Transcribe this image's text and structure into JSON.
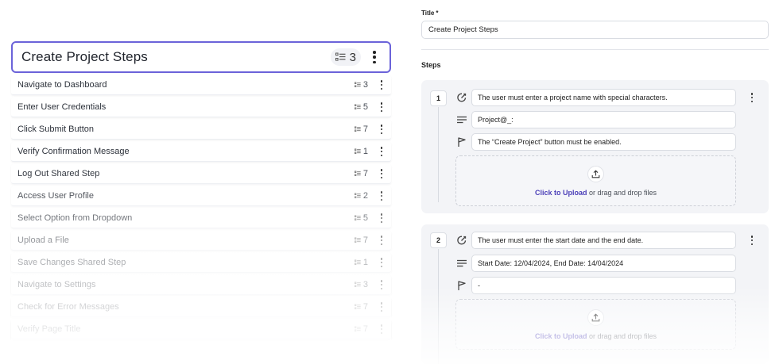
{
  "selected_shared_step": {
    "title": "Create Project Steps",
    "step_count": "3",
    "count_icon": "list-steps-icon",
    "menu_icon": "kebab-menu-icon"
  },
  "shared_steps": [
    {
      "label": "Navigate to Dashboard",
      "count": "3"
    },
    {
      "label": "Enter User Credentials",
      "count": "5"
    },
    {
      "label": "Click Submit Button",
      "count": "7"
    },
    {
      "label": "Verify Confirmation Message",
      "count": "1"
    },
    {
      "label": "Log Out Shared Step",
      "count": "7"
    },
    {
      "label": "Access User Profile",
      "count": "2"
    },
    {
      "label": "Select Option from Dropdown",
      "count": "5"
    },
    {
      "label": "Upload a File",
      "count": "7"
    },
    {
      "label": "Save Changes Shared Step",
      "count": "1"
    },
    {
      "label": "Navigate to Settings",
      "count": "3"
    },
    {
      "label": "Check for Error Messages",
      "count": "7"
    },
    {
      "label": "Verify Page Title",
      "count": "7"
    }
  ],
  "form": {
    "title_label": "Title",
    "required_marker": "*",
    "title_value": "Create Project Steps",
    "steps_label": "Steps"
  },
  "steps": [
    {
      "number": "1",
      "action": "The user must enter a project name with special characters.",
      "data": "Project@_:",
      "expected": "The “Create Project” button must be enabled.",
      "upload_link": "Click to Upload",
      "upload_rest": " or drag and drop files"
    },
    {
      "number": "2",
      "action": "The user must enter the start date and the end date.",
      "data": "Start Date: 12/04/2024, End Date: 14/04/2024",
      "expected": "-",
      "upload_link": "Click to Upload",
      "upload_rest": " or drag and drop files"
    }
  ],
  "colors": {
    "accent": "#6b63d9",
    "link": "#4b3fb8",
    "card_bg": "#f3f4f7"
  },
  "icons": {
    "action": "edit-circle-icon",
    "data": "text-lines-icon",
    "expected": "flag-icon",
    "upload": "upload-icon"
  }
}
